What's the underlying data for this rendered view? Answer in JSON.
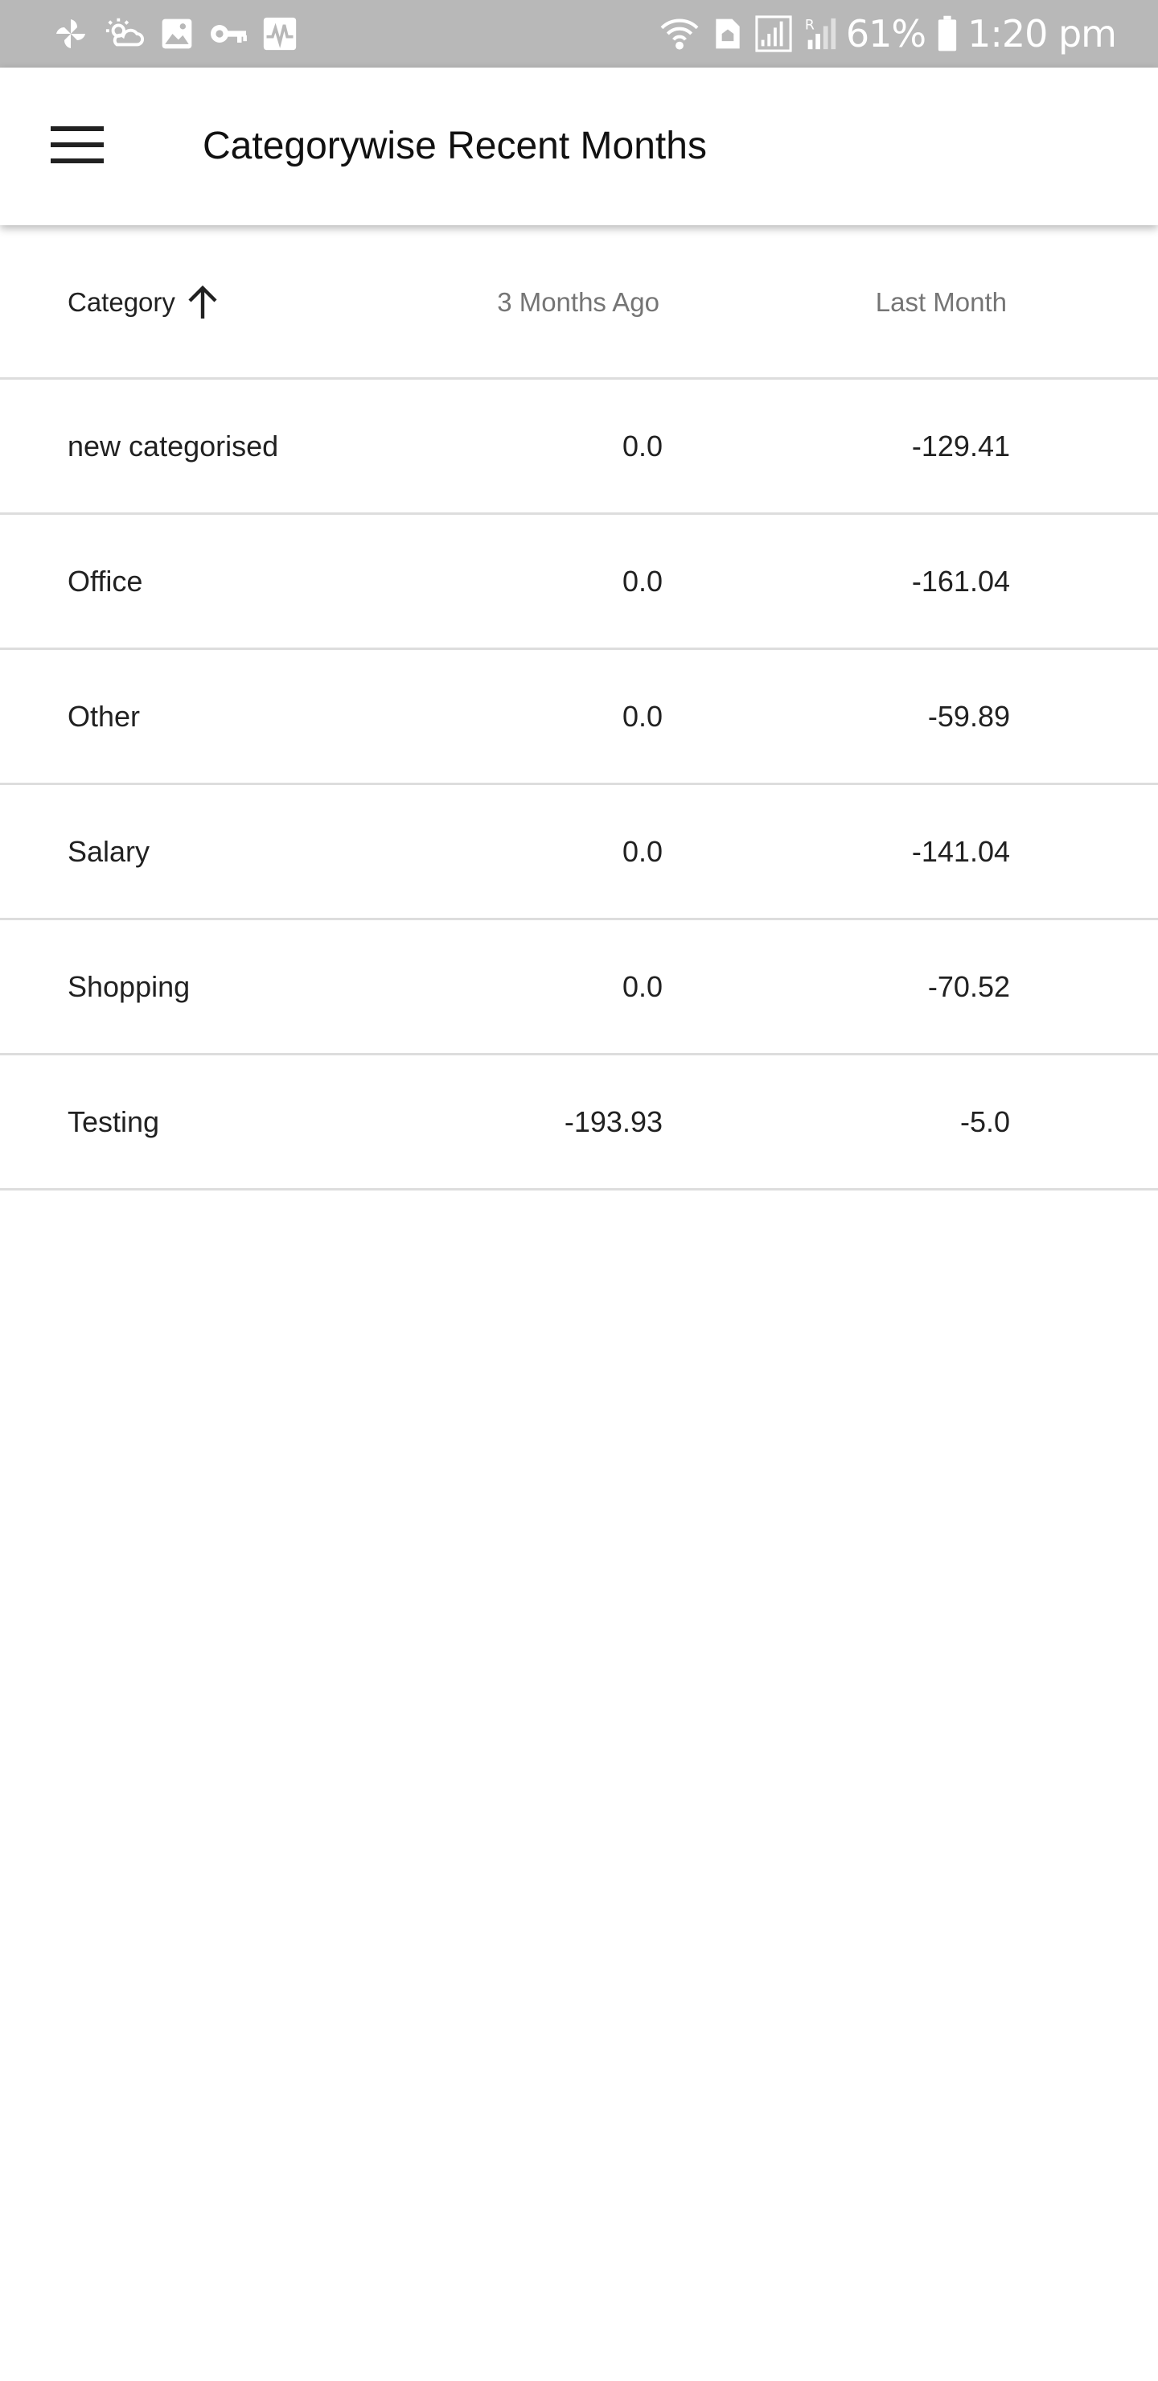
{
  "status_bar": {
    "icons_left": [
      "pinwheel-icon",
      "weather-icon",
      "image-icon",
      "key-icon",
      "activity-icon"
    ],
    "icons_right": [
      "wifi-icon",
      "sim-icon",
      "signal-icon",
      "signal-roaming-icon",
      "battery-icon"
    ],
    "battery": "61%",
    "time": "1:20 pm",
    "color": "#b8b8b8"
  },
  "app_bar": {
    "menu_icon": "hamburger-menu-icon",
    "title": "Categorywise Recent Months"
  },
  "table": {
    "columns": [
      {
        "label": "Category",
        "sort": "ascending",
        "sort_icon": "arrow-up-icon"
      },
      {
        "label": "3 Months Ago"
      },
      {
        "label": "Last Month"
      }
    ],
    "rows": [
      {
        "category": "new categorised",
        "three_months_ago": "0.0",
        "last_month": "-129.41"
      },
      {
        "category": "Office",
        "three_months_ago": "0.0",
        "last_month": "-161.04"
      },
      {
        "category": "Other",
        "three_months_ago": "0.0",
        "last_month": "-59.89"
      },
      {
        "category": "Salary",
        "three_months_ago": "0.0",
        "last_month": "-141.04"
      },
      {
        "category": "Shopping",
        "three_months_ago": "0.0",
        "last_month": "-70.52"
      },
      {
        "category": "Testing",
        "three_months_ago": "-193.93",
        "last_month": "-5.0"
      }
    ]
  }
}
